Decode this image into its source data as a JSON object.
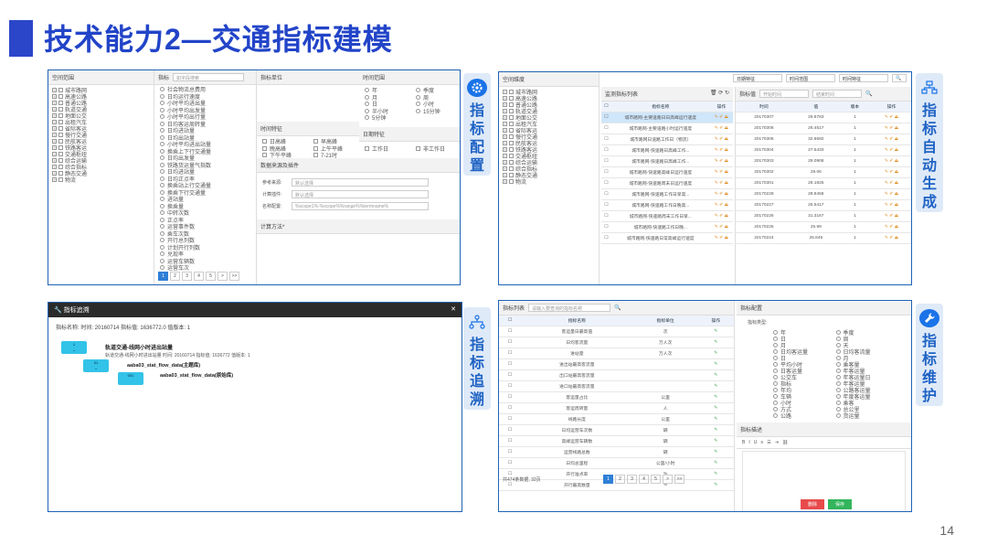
{
  "slide": {
    "title": "技术能力2—交通指标建模",
    "page_number": "14"
  },
  "labels": {
    "config": "指标配置",
    "auto": "指标自动生成",
    "trace": "指标追溯",
    "maintain": "指标维护"
  },
  "panel1": {
    "space_header": "空间范围",
    "indicator_header": "指标",
    "indicator_search_placeholder": "如字段搜索",
    "unit_header": "指标单位",
    "time_header": "时间范围",
    "tree": [
      "城市路网",
      "高速公路",
      "普通公路",
      "轨道交通",
      "地面公交",
      "出租汽车",
      "省际客运",
      "慢行交通",
      "民航客运",
      "铁路客运",
      "交通枢纽",
      "综合运输",
      "综合指标",
      "静态交通",
      "物流"
    ],
    "indicators": [
      "社会物流总费用",
      "日均运行速度",
      "小时平均进出量",
      "小时平均出发量",
      "小时平均出行量",
      "日均客运周转量",
      "日均进站量",
      "日均出站量",
      "小时平均进出站量",
      "换乘上下行交通量",
      "日均出发量",
      "铁路货运量气指数",
      "日均进站量",
      "日均正点率",
      "换乘站上行交通量",
      "换乘下行交通量",
      "进站量",
      "换乘量",
      "中转次数",
      "正点率",
      "运营事件数",
      "乘车次数",
      "开行总列数",
      "计划开行列数",
      "兑现率",
      "运营车辆数",
      "运营车次"
    ],
    "time_options": [
      "年",
      "季度",
      "月",
      "周",
      "日",
      "小时",
      "半小时",
      "15分钟",
      "5分钟"
    ],
    "time_feature_header": "时间特征",
    "time_features": [
      "日高峰",
      "早高峰",
      "晚高峰",
      "上午平峰",
      "下午平峰",
      "7-21时"
    ],
    "day_feature_header": "日期特征",
    "day_features": [
      "工作日",
      "非工作日"
    ],
    "data_source_header": "数据来源及插件",
    "form": [
      {
        "label": "参考来源:",
        "value": "默认选择"
      },
      {
        "label": "计算插件:",
        "value": "默认选择"
      },
      {
        "label": "名称配置:",
        "value": "%scope1%-%scope%%range%%termname%"
      }
    ],
    "formula_header": "计算方法*",
    "pager": [
      "1",
      "2",
      "3",
      "4",
      "5",
      ">",
      ">>"
    ]
  },
  "panel2": {
    "space_header": "空间维度",
    "tree": [
      "城市路网",
      "高速公路",
      "普通公路",
      "轨道交通",
      "地面公交",
      "出租汽车",
      "省际客运",
      "慢行交通",
      "民航客运",
      "铁路客运",
      "交通枢纽",
      "综合运输",
      "综合指标",
      "静态交通",
      "物流"
    ],
    "filters": [
      "日期特征",
      "时间范围",
      "时间特征"
    ],
    "list_title": "监测指标列表",
    "list_columns": [
      "指标名称",
      "操作"
    ],
    "value_title": "指标值",
    "start_placeholder": "开始时间",
    "end_placeholder": "结束时间",
    "value_columns": [
      "时间",
      "值",
      "版本",
      "操作"
    ],
    "rows": [
      {
        "name": "城市路网-主要道路日日高峰运行速度",
        "time": "20170307",
        "value": "29.8783",
        "version": "1"
      },
      {
        "name": "城市路网-主要道路小时运行速度",
        "time": "20170306",
        "value": "26.4517",
        "version": "1"
      },
      {
        "name": "城市路网日道路工作日（物流）",
        "time": "20170305",
        "value": "32.6692",
        "version": "1"
      },
      {
        "name": "城市路网-快速路日高峰工作...",
        "time": "20170304",
        "value": "27.5433",
        "version": "1"
      },
      {
        "name": "城市路网-快速路日高峰工作...",
        "time": "20170303",
        "value": "29.0908",
        "version": "1"
      },
      {
        "name": "城市路网-快速路高峰日运行速度",
        "time": "20170302",
        "value": "29.06",
        "version": "1"
      },
      {
        "name": "城市路网-快速路周末日运行速度",
        "time": "20170301",
        "value": "28.1825",
        "version": "1"
      },
      {
        "name": "城市路网-快速路工作日早高...",
        "time": "20170228",
        "value": "28.8458",
        "version": "1"
      },
      {
        "name": "城市路网-快速路工作日晚高...",
        "time": "20170227",
        "value": "25.5417",
        "version": "1"
      },
      {
        "name": "城市路网-快速路周末工作日早...",
        "time": "20170226",
        "value": "31.3167",
        "version": "1"
      },
      {
        "name": "城市路网-快速路工作日晚...",
        "time": "20170225",
        "value": "25.99",
        "version": "1"
      },
      {
        "name": "城市路网-快速路日常高峰运行速度",
        "time": "20170224",
        "value": "26.845",
        "version": "1"
      }
    ],
    "op_text": "✎ ✐ ⏏"
  },
  "panel3": {
    "header": "指标追溯",
    "meta": "指标名称: 时间: 20160714 指标值: 1636772.0 值版本: 1",
    "main_title": "轨道交通-线网小时进出站量",
    "main_sub": "轨道交通-线网小时进出站量 时间: 20160714 指标值: 1636772 值版本: 1",
    "node1_label": "aaba03_stat_flow_data(主题库)",
    "node2_label": "aaba03_stat_flow_data(原始库)",
    "node_codes": [
      "1",
      "01",
      "001"
    ]
  },
  "panel4": {
    "list_header": "指标列表",
    "search_placeholder": "请输入要查询的指标名称",
    "columns": [
      "指标名称",
      "指标单位",
      "操作"
    ],
    "rows": [
      {
        "name": "客运量日最高值",
        "unit": "次"
      },
      {
        "name": "日均客流量",
        "unit": "万人次"
      },
      {
        "name": "进站量",
        "unit": "万人次"
      },
      {
        "name": "进出站最高客流量",
        "unit": ""
      },
      {
        "name": "出口站最高客流量",
        "unit": ""
      },
      {
        "name": "进口站最高客流量",
        "unit": ""
      },
      {
        "name": "客运量占比",
        "unit": "公里"
      },
      {
        "name": "客运周转量",
        "unit": "人"
      },
      {
        "name": "线路长度",
        "unit": "公里"
      },
      {
        "name": "日均运营车次数",
        "unit": "辆"
      },
      {
        "name": "高峰运营车辆数",
        "unit": "辆"
      },
      {
        "name": "运营线路总数",
        "unit": "辆"
      },
      {
        "name": "日均总里程",
        "unit": "公里/小时"
      },
      {
        "name": "开行准点率",
        "unit": "%"
      },
      {
        "name": "开行最高数量",
        "unit": "%"
      }
    ],
    "footer": "共474条数据, 32页",
    "pager": [
      "1",
      "2",
      "3",
      "4",
      "5",
      ">",
      ">>"
    ],
    "config_header": "指标配置",
    "config_label": "指标类型:",
    "options": [
      "年",
      "季度",
      "日",
      "周",
      "月",
      "天",
      "日均客运量",
      "日均客流量",
      "日",
      "月",
      "平均小时",
      "乘客量",
      "日客运量",
      "年客运量",
      "公交车",
      "年客运量日",
      "指标",
      "年客运量",
      "年均",
      "公路客运量",
      "车辆",
      "年度客运量",
      "小时",
      "乘客",
      "方式",
      "总公里",
      "公路",
      "货运量"
    ],
    "desc_header": "指标描述",
    "delete_btn": "删除",
    "save_btn": "保存"
  }
}
